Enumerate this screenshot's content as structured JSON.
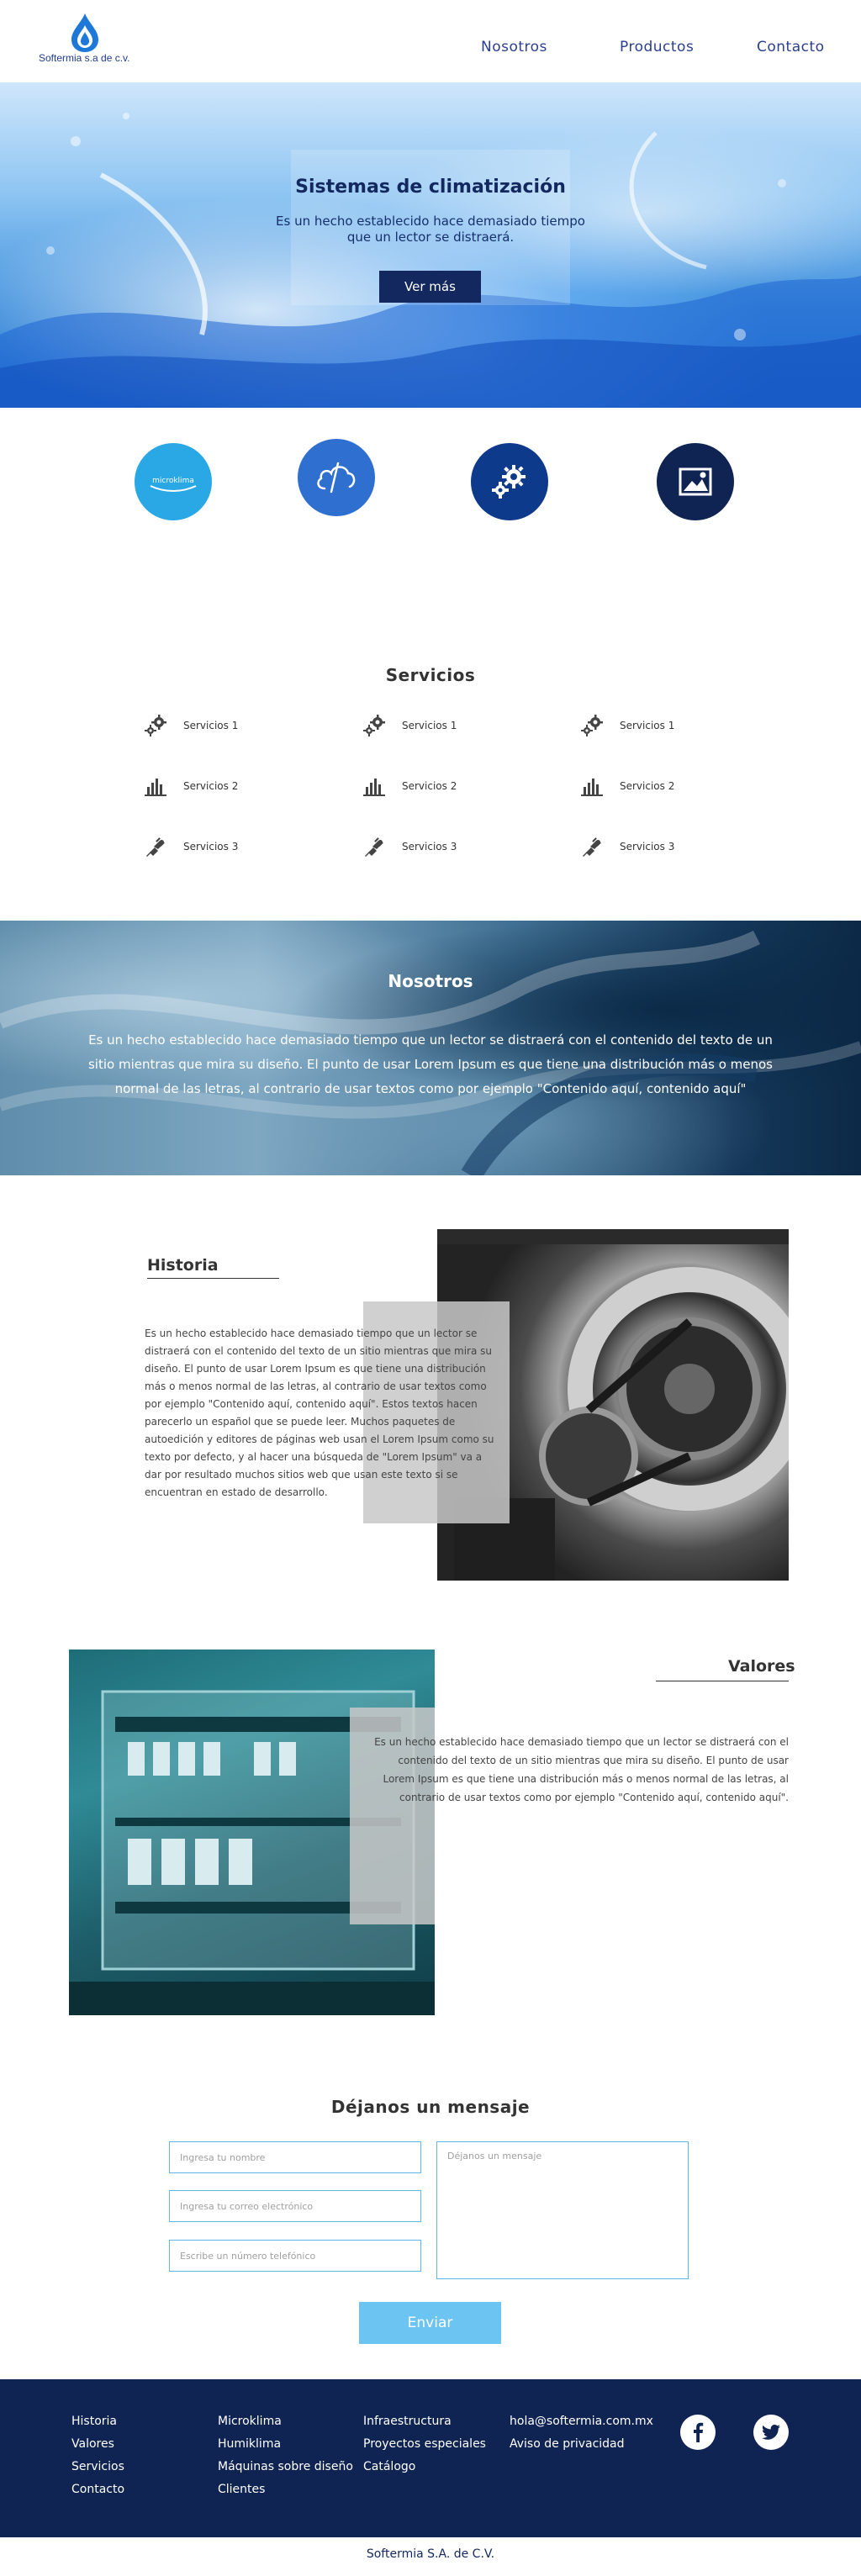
{
  "brand": {
    "logo_text": "Softermia s.a de c.v."
  },
  "nav": {
    "items": [
      "Nosotros",
      "Productos",
      "Contacto"
    ]
  },
  "hero": {
    "title": "Sistemas de climatización",
    "subtitle": "Es un hecho establecido hace demasiado tiempo que un lector se distraerá.",
    "button_label": "Ver más"
  },
  "feature_icons": [
    {
      "label": "microklima"
    },
    {
      "icon": "cloud-logo-icon"
    },
    {
      "icon": "gears-icon"
    },
    {
      "icon": "image-icon"
    }
  ],
  "services": {
    "title": "Servicios",
    "columns": [
      [
        "Servicios 1",
        "Servicios 2",
        "Servicios 3"
      ],
      [
        "Servicios 1",
        "Servicios 2",
        "Servicios 3"
      ],
      [
        "Servicios 1",
        "Servicios 2",
        "Servicios 3"
      ]
    ]
  },
  "about": {
    "title": "Nosotros",
    "text": "Es un hecho establecido hace demasiado tiempo que un lector se distraerá con el contenido del texto de un sitio mientras que mira su diseño. El punto de usar Lorem Ipsum es que tiene una distribución más o menos normal de las letras, al contrario de usar textos como por ejemplo \"Contenido aquí, contenido aquí\""
  },
  "history": {
    "title": "Historia",
    "text": "Es un hecho establecido hace demasiado tiempo que un lector se distraerá con el contenido del texto de un sitio mientras que mira su diseño. El punto de usar Lorem Ipsum es que tiene una distribución más o menos normal de las letras, al contrario de usar textos como por ejemplo \"Contenido aquí, contenido aquí\". Estos textos hacen parecerlo un español que se puede leer. Muchos paquetes de autoedición y editores de páginas web usan el Lorem Ipsum como su texto por defecto, y al hacer una búsqueda de \"Lorem Ipsum\" va a dar por resultado muchos sitios web que usan este texto si se encuentran en estado de desarrollo."
  },
  "values": {
    "title": "Valores",
    "text": "Es un hecho establecido hace demasiado tiempo que un lector se distraerá con el contenido del texto de un sitio mientras que mira su diseño. El punto de usar Lorem Ipsum es que tiene una distribución más o menos normal de las letras, al contrario de usar textos como por ejemplo \"Contenido aquí, contenido aquí\"."
  },
  "contact_form": {
    "title": "Déjanos un mensaje",
    "name_placeholder": "Ingresa tu nombre",
    "email_placeholder": "Ingresa tu correo electrónico",
    "phone_placeholder": "Escribe un número telefónico",
    "message_placeholder": "Déjanos un mensaje",
    "submit_label": "Enviar"
  },
  "footer": {
    "col1": [
      "Historia",
      "Valores",
      "Servicios",
      "Contacto"
    ],
    "col2": [
      "Microklima",
      "Humiklima",
      "Máquinas sobre diseño",
      "Clientes"
    ],
    "col3": [
      "Infraestructura",
      "Proyectos especiales",
      "Catálogo"
    ],
    "col4": [
      "hola@softermia.com.mx",
      "Aviso de privacidad"
    ],
    "social": [
      "facebook-icon",
      "twitter-icon"
    ],
    "copyright": "Softermia S.A. de C.V."
  },
  "colors": {
    "navy": "#0f2452",
    "nav_text": "#2a3f8f",
    "accent_blue": "#6cc4f2",
    "input_border": "#5fb4ea",
    "circle_1": "#2aa8e6",
    "circle_2": "#2f6fd0",
    "circle_3": "#0e3a8c",
    "circle_4": "#0f2452"
  }
}
